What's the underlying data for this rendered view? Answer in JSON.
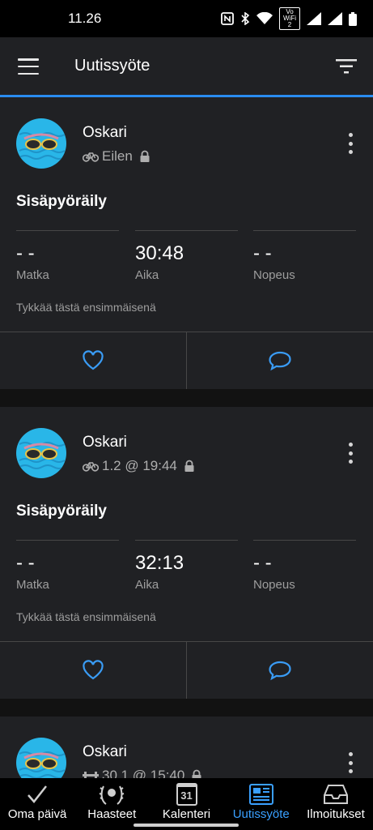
{
  "status_bar": {
    "time": "11.26",
    "wifi_label": "Vo WiFi 2"
  },
  "app_bar": {
    "title": "Uutissyöte"
  },
  "colors": {
    "accent": "#2a8cf0",
    "active_nav": "#3aa0ff",
    "card_bg": "#202124",
    "avatar_bg": "#29b6e8"
  },
  "icons": {
    "menu": "hamburger-menu-icon",
    "filter": "filter-icon",
    "like": "heart-icon",
    "comment": "comment-bubble-icon",
    "activity": "bike-icon",
    "private": "lock-icon"
  },
  "feed": [
    {
      "name": "Oskari",
      "time": "Eilen",
      "title": "Sisäpyöräily",
      "stats": [
        {
          "value": "- -",
          "label": "Matka"
        },
        {
          "value": "30:48",
          "label": "Aika"
        },
        {
          "value": "- -",
          "label": "Nopeus"
        }
      ],
      "like_text": "Tykkää tästä ensimmäisenä"
    },
    {
      "name": "Oskari",
      "time": "1.2 @ 19:44",
      "title": "Sisäpyöräily",
      "stats": [
        {
          "value": "- -",
          "label": "Matka"
        },
        {
          "value": "32:13",
          "label": "Aika"
        },
        {
          "value": "- -",
          "label": "Nopeus"
        }
      ],
      "like_text": "Tykkää tästä ensimmäisenä"
    },
    {
      "name": "Oskari",
      "time": "30.1 @ 15:40"
    }
  ],
  "bottom_nav": [
    {
      "label": "Oma päivä"
    },
    {
      "label": "Haasteet"
    },
    {
      "label": "Kalenteri",
      "icon_text": "31"
    },
    {
      "label": "Uutissyöte",
      "active": true
    },
    {
      "label": "Ilmoitukset"
    }
  ]
}
